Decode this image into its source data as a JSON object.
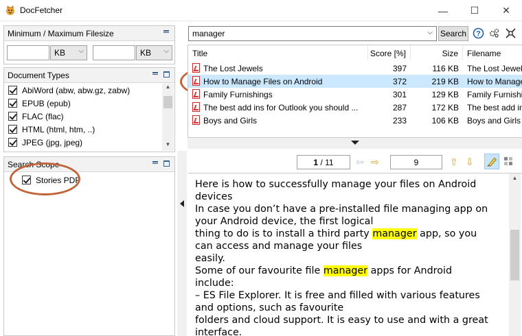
{
  "window": {
    "title": "DocFetcher",
    "controls": {
      "minimize": "—",
      "maximize": "☐",
      "close": "✕"
    }
  },
  "filesize_panel": {
    "title": "Minimum / Maximum Filesize",
    "min_value": "",
    "min_unit": "KB",
    "max_value": "",
    "max_unit": "KB"
  },
  "doctypes_panel": {
    "title": "Document Types",
    "items": [
      {
        "label": "AbiWord (abw, abw.gz, zabw)",
        "checked": true
      },
      {
        "label": "EPUB (epub)",
        "checked": true
      },
      {
        "label": "FLAC (flac)",
        "checked": true
      },
      {
        "label": "HTML (html, htm, ..)",
        "checked": true
      },
      {
        "label": "JPEG (jpg, jpeg)",
        "checked": true
      }
    ]
  },
  "scope_panel": {
    "title": "Search Scope",
    "items": [
      {
        "label": "Stories PDF",
        "checked": true
      }
    ]
  },
  "search": {
    "query": "manager",
    "button_label": "Search",
    "icons": [
      "help-icon",
      "settings-icon",
      "compact-view-icon"
    ]
  },
  "results": {
    "columns": [
      "Title",
      "Score [%]",
      "Size",
      "Filename"
    ],
    "rows": [
      {
        "title": "The Lost Jewels",
        "score": "397",
        "size": "116 KB",
        "filename": "The Lost Jewels",
        "selected": false
      },
      {
        "title": "How to Manage Files on Android",
        "score": "372",
        "size": "219 KB",
        "filename": "How to Manage",
        "selected": true
      },
      {
        "title": "Family Furnishings",
        "score": "301",
        "size": "129 KB",
        "filename": "Family Furnishings",
        "selected": false
      },
      {
        "title": "The best add ins for Outlook you should ...",
        "score": "287",
        "size": "172 KB",
        "filename": "The best add ins",
        "selected": false
      },
      {
        "title": "Boys and Girls",
        "score": "233",
        "size": "106 KB",
        "filename": "Boys and Girls",
        "selected": false
      }
    ]
  },
  "preview_toolbar": {
    "page_current": "1",
    "page_total": "/ 11",
    "match_count": "9"
  },
  "preview": {
    "lines": [
      [
        {
          "t": "Here is how to successfully manage your files on Android"
        }
      ],
      [
        {
          "t": "devices"
        }
      ],
      [
        {
          "t": "In case you don’t have a pre-installed file managing app on"
        }
      ],
      [
        {
          "t": "your Android device, the first logical"
        }
      ],
      [
        {
          "t": "thing to do is to install a third party "
        },
        {
          "t": "manager",
          "hl": true
        },
        {
          "t": " app, so you"
        }
      ],
      [
        {
          "t": "can access and manage your files"
        }
      ],
      [
        {
          "t": "easily."
        }
      ],
      [
        {
          "t": "Some of our favourite file "
        },
        {
          "t": "manager",
          "hl": true
        },
        {
          "t": " apps for Android"
        }
      ],
      [
        {
          "t": "include:"
        }
      ],
      [
        {
          "t": "–  ES File Explorer.  It is free and filled with various features"
        }
      ],
      [
        {
          "t": "and options, such as favourite"
        }
      ],
      [
        {
          "t": "folders and cloud support. It is easy to use and with a great"
        }
      ],
      [
        {
          "t": "interface."
        }
      ]
    ]
  },
  "colors": {
    "selection": "#cce8ff",
    "highlight": "#ffff00",
    "annotation": "#c0653a",
    "pdf_red": "#cc2a2a"
  }
}
